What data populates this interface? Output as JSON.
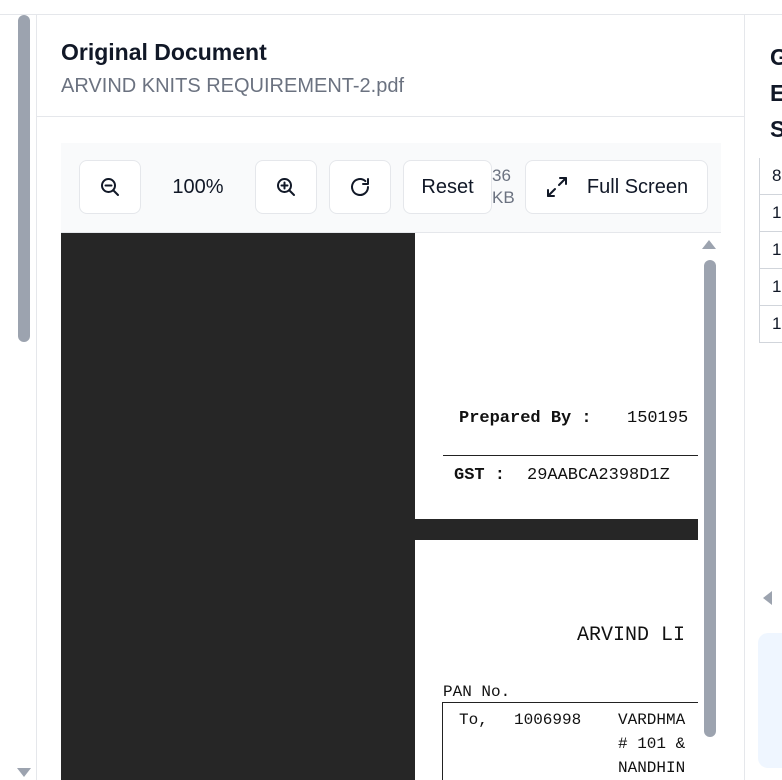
{
  "panel": {
    "title": "Original Document",
    "filename": "ARVIND KNITS REQUIREMENT-2.pdf"
  },
  "toolbar": {
    "zoom_out_icon": "zoom-out-icon",
    "zoom_level": "100%",
    "zoom_in_icon": "zoom-in-icon",
    "rotate_icon": "rotate-icon",
    "reset_label": "Reset",
    "size_label": "36 KB",
    "fullscreen_icon": "expand-icon",
    "fullscreen_label": "Full Screen"
  },
  "document": {
    "page1": {
      "prepared_by_label": "Prepared By :",
      "prepared_by_value": "150195",
      "gst_label": "GST :",
      "gst_value": "29AABCA2398D1Z"
    },
    "page2": {
      "company": "ARVIND LI",
      "pan_label": "PAN No.",
      "to_label": "To,",
      "to_code": "1006998",
      "to_line1": "VARDHMA",
      "to_line2": "# 101 &",
      "to_line3": "NANDHIN"
    }
  },
  "right_panel": {
    "title_lines": [
      "G",
      "E",
      "S"
    ],
    "table_rows": [
      "8",
      "1",
      "1",
      "1",
      "1"
    ]
  },
  "colors": {
    "viewer_background": "#262626",
    "scrollbar": "#9ca3af",
    "muted_text": "#6b7280",
    "card_background": "#eff6ff"
  }
}
